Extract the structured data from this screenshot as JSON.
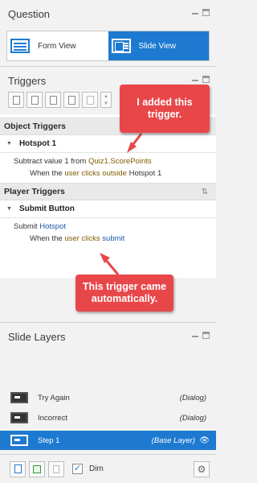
{
  "question": {
    "title": "Question",
    "views": [
      {
        "label": "Form View",
        "active": false
      },
      {
        "label": "Slide View",
        "active": true
      }
    ]
  },
  "triggers": {
    "title": "Triggers",
    "toolbar_icons": [
      "new-trigger-icon",
      "edit-trigger-icon",
      "copy-icon",
      "paste-icon",
      "delete-icon",
      "move-up-icon",
      "move-down-icon"
    ],
    "object_triggers": {
      "title": "Object Triggers",
      "object": "Hotspot 1",
      "action_prefix": "Subtract value 1 from ",
      "action_var": "Quiz1.ScorePoints",
      "cond_prefix": "When the ",
      "cond_event": "user clicks outside",
      "cond_target": " Hotspot 1"
    },
    "player_triggers": {
      "title": "Player Triggers",
      "object": "Submit Button",
      "action_prefix": "Submit ",
      "action_target": "Hotspot",
      "cond_prefix": "When the ",
      "cond_event": "user clicks",
      "cond_target": "submit"
    }
  },
  "callouts": {
    "added": "I added this trigger.",
    "auto": "This trigger came automatically."
  },
  "slide_layers": {
    "title": "Slide Layers",
    "layers": [
      {
        "name": "Try Again",
        "type": "(Dialog)"
      },
      {
        "name": "Incorrect",
        "type": "(Dialog)"
      },
      {
        "name": "Step 1",
        "type": "(Base Layer)",
        "active": true
      }
    ],
    "dim_label": "Dim",
    "dim_checked": true
  },
  "colors": {
    "accent": "#1e7ad0",
    "callout": "#e8474a",
    "variable_highlight": "#7f5d00",
    "link_blue": "#1e5aa8"
  }
}
